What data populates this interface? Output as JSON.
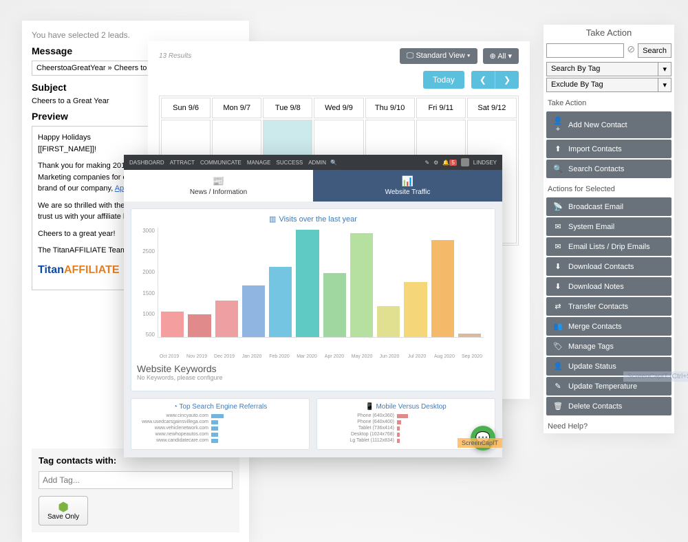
{
  "email": {
    "selected": "You have selected 2 leads.",
    "message_label": "Message",
    "template": "CheerstoaGreatYear » Cheers to a Great Year",
    "subject_label": "Subject",
    "subject": "Cheers to a Great Year",
    "preview_label": "Preview",
    "preview_greeting": "Happy Holidays [[FIRST_NAME]]!",
    "preview_p1a": "Thank you for making 2019 ",
    "preview_p1b": "Marketing companies for ov",
    "preview_p1c": "brand of our company, ",
    "preview_link": "Apo",
    "preview_p2": "We are so thrilled with the c trust us with your affiliate b",
    "preview_p3": "Cheers to a great year!",
    "preview_sign": "The TitanAFFILIATE Team",
    "brand1": "Titan",
    "brand2": "AFFILIATE",
    "tag_label": "Tag contacts with:",
    "tag_placeholder": "Add Tag...",
    "save_label": "Save Only"
  },
  "cal": {
    "results": "13 Results",
    "std_view": "Standard View",
    "all": "All",
    "today": "Today",
    "days": [
      "Sun 9/6",
      "Mon 9/7",
      "Tue 9/8",
      "Wed 9/9",
      "Thu 9/10",
      "Fri 9/11",
      "Sat 9/12"
    ]
  },
  "side": {
    "title": "Take Action",
    "search_btn": "Search",
    "search_tag": "Search By Tag",
    "exclude_tag": "Exclude By Tag",
    "take_action": "Take Action",
    "actions1": [
      {
        "icon": "👤+",
        "label": "Add New Contact"
      },
      {
        "icon": "⬆",
        "label": "Import Contacts"
      },
      {
        "icon": "🔍",
        "label": "Search Contacts"
      }
    ],
    "actions_selected": "Actions for Selected",
    "actions2": [
      {
        "icon": "📡",
        "label": "Broadcast Email"
      },
      {
        "icon": "✉",
        "label": "System Email"
      },
      {
        "icon": "✉",
        "label": "Email Lists / Drip Emails"
      },
      {
        "icon": "⬇",
        "label": "Download Contacts"
      },
      {
        "icon": "⬇",
        "label": "Download Notes"
      },
      {
        "icon": "⇄",
        "label": "Transfer Contacts"
      },
      {
        "icon": "👥",
        "label": "Merge Contacts"
      },
      {
        "icon": "🏷",
        "label": "Manage Tags"
      },
      {
        "icon": "👤",
        "label": "Update Status"
      },
      {
        "icon": "✎",
        "label": "Update Temperature"
      },
      {
        "icon": "🗑",
        "label": "Delete Contacts"
      }
    ],
    "need_help": "Need Help?",
    "watermark": "ScreenCapIT (Ctrl+Shift+"
  },
  "dash": {
    "nav": [
      "DASHBOARD",
      "ATTRACT",
      "COMMUNICATE",
      "MANAGE",
      "SUCCESS",
      "ADMIN"
    ],
    "user": "LINDSEY",
    "alert": "5",
    "tab1_title": "News / Information",
    "tab2_title": "Website Traffic",
    "chart_title": "Visits over the last year",
    "kw_h": "Website Keywords",
    "kw_s": "No Keywords, please configure",
    "referrals_title": "Top Search Engine Referrals",
    "referrals": [
      {
        "label": "www.cincyauto.com",
        "w": 18
      },
      {
        "label": "www.usedcarsgainsvillega.com",
        "w": 10
      },
      {
        "label": "www.vehiclenetwork.com",
        "w": 10
      },
      {
        "label": "www.newhopeautos.com",
        "w": 10
      },
      {
        "label": "www.candidatecare.com",
        "w": 10
      }
    ],
    "mobile_title": "Mobile Versus Desktop",
    "mobile": [
      {
        "label": "Phone (640x360)",
        "w": 16
      },
      {
        "label": "Phone (640x400)",
        "w": 6
      },
      {
        "label": "Tablet (736x414)",
        "w": 4
      },
      {
        "label": "Desktop (1024x768)",
        "w": 4
      },
      {
        "label": "Lg Tablet (1112x834)",
        "w": 4
      }
    ],
    "sc_badge": "ScreenCapIT"
  },
  "chart_data": {
    "type": "bar",
    "title": "Visits over the last year",
    "categories": [
      "Oct 2019",
      "Nov 2019",
      "Dec 2019",
      "Jan 2020",
      "Feb 2020",
      "Mar 2020",
      "Apr 2020",
      "May 2020",
      "Jun 2020",
      "Jul 2020",
      "Aug 2020",
      "Sep 2020"
    ],
    "values": [
      700,
      620,
      1000,
      1400,
      1920,
      2920,
      1740,
      2830,
      850,
      1500,
      2640,
      100
    ],
    "colors": [
      "#f49ea0",
      "#e08a8c",
      "#ee9fa2",
      "#8fb5e0",
      "#74c5e2",
      "#5fc9c4",
      "#a0d6a0",
      "#b5e0a0",
      "#e0e090",
      "#f5d779",
      "#f5b96a",
      "#d9b9a0"
    ],
    "ylim": [
      0,
      3000
    ],
    "yticks": [
      3000,
      2500,
      2000,
      1500,
      1000,
      500
    ]
  }
}
